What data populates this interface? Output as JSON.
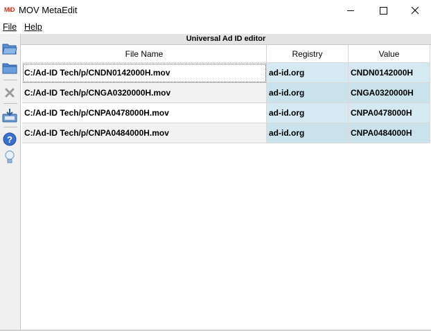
{
  "window": {
    "icon_text": "MiD",
    "title": "MOV MetaEdit",
    "controls": {
      "minimize": "minimize-icon",
      "maximize": "maximize-icon",
      "close": "close-icon"
    }
  },
  "menu": {
    "file": "File",
    "help": "Help"
  },
  "toolbar": {
    "tools": [
      {
        "name": "open-folder-icon",
        "color": "#4a7fc1"
      },
      {
        "name": "open-directory-icon",
        "color": "#4a7fc1"
      },
      {
        "name": "remove-icon",
        "color": "#9a9a9a"
      },
      {
        "name": "save-icon",
        "color": "#4a7fc1"
      },
      {
        "name": "help-icon",
        "color": "#3b6fd0"
      },
      {
        "name": "about-lightbulb-icon",
        "color": "#7aa0c8"
      }
    ]
  },
  "panel": {
    "title": "Universal Ad ID editor",
    "columns": [
      "File Name",
      "Registry",
      "Value"
    ],
    "rows": [
      {
        "file": "C:/Ad-ID Tech/p/CNDN0142000H.mov",
        "registry": "ad-id.org",
        "value": "CNDN0142000H"
      },
      {
        "file": "C:/Ad-ID Tech/p/CNGA0320000H.mov",
        "registry": "ad-id.org",
        "value": "CNGA0320000H"
      },
      {
        "file": "C:/Ad-ID Tech/p/CNPA0478000H.mov",
        "registry": "ad-id.org",
        "value": "CNPA0478000H"
      },
      {
        "file": "C:/Ad-ID Tech/p/CNPA0484000H.mov",
        "registry": "ad-id.org",
        "value": "CNPA0484000H"
      }
    ]
  },
  "colors": {
    "registry_value_bg": "#d4e9f1",
    "alt_row_bg": "#f2f2f2",
    "toolbar_bg": "#f0f0f0"
  }
}
